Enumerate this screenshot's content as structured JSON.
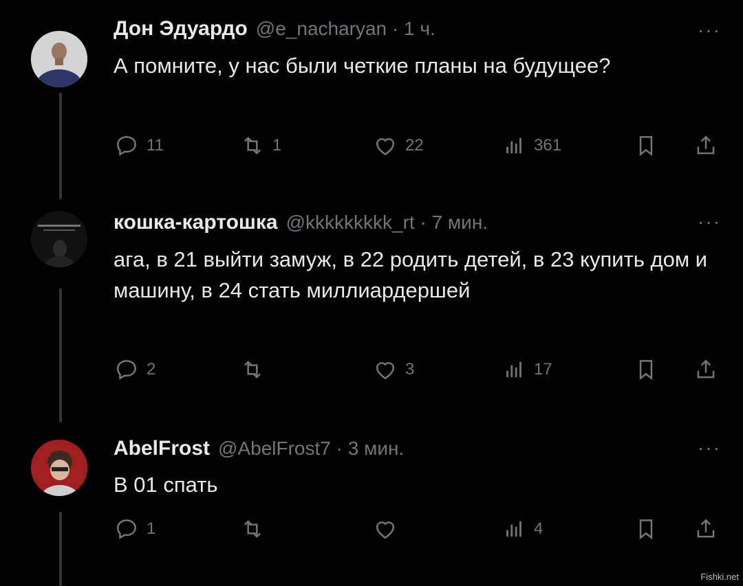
{
  "tweets": [
    {
      "name": "Дон Эдуардо",
      "meta": "@e_nacharyan · 1 ч.",
      "more": "···",
      "text": "А помните, у нас были четкие планы на будущее?",
      "stats": {
        "replies": "11",
        "retweets": "1",
        "likes": "22",
        "views": "361"
      }
    },
    {
      "name": "кошка-картошка",
      "meta": "@kkkkkkkkk_rt · 7 мин.",
      "more": "···",
      "text": "ага, в 21 выйти замуж, в 22 родить детей, в 23 купить дом и машину, в 24 стать миллиардершей",
      "stats": {
        "replies": "2",
        "retweets": "",
        "likes": "3",
        "views": "17"
      }
    },
    {
      "name": "AbelFrost",
      "meta": "@AbelFrost7 · 3 мин.",
      "more": "···",
      "text": "В 01 спать",
      "stats": {
        "replies": "1",
        "retweets": "",
        "likes": "",
        "views": "4"
      }
    }
  ],
  "watermark": "Fishki.net",
  "colors": {
    "background": "#000000",
    "text": "#e7e9ea",
    "secondary": "#71767b",
    "thread_line": "#333639"
  }
}
